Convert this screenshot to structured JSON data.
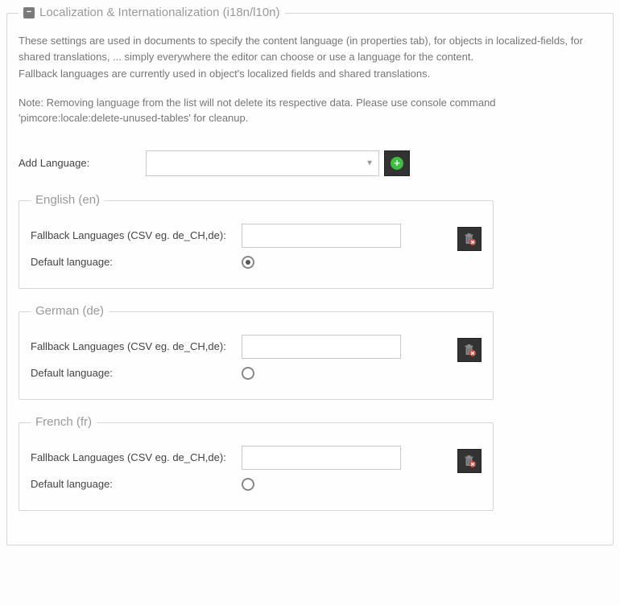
{
  "panel": {
    "title": "Localization & Internationalization (i18n/l10n)",
    "description_p1": "These settings are used in documents to specify the content language (in properties tab), for objects in localized-fields, for shared translations, ... simply everywhere the editor can choose or use a language for the content.",
    "description_p2": "Fallback languages are currently used in object's localized fields and shared translations.",
    "description_p3": "Note: Removing language from the list will not delete its respective data. Please use console command 'pimcore:locale:delete-unused-tables' for cleanup."
  },
  "add": {
    "label": "Add Language:",
    "selected": ""
  },
  "row_labels": {
    "fallback": "Fallback Languages (CSV eg. de_CH,de):",
    "default": "Default language:"
  },
  "languages": [
    {
      "title": "English (en)",
      "fallback": "",
      "default": true
    },
    {
      "title": "German (de)",
      "fallback": "",
      "default": false
    },
    {
      "title": "French (fr)",
      "fallback": "",
      "default": false
    }
  ]
}
